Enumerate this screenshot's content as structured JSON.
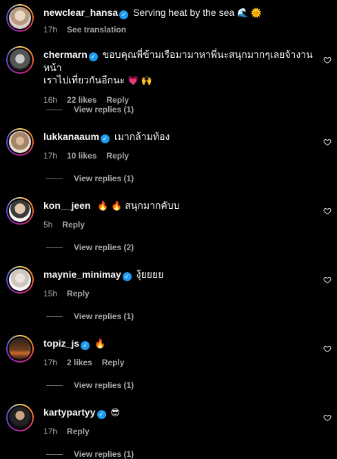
{
  "comments": [
    {
      "username": "newclear_hansa",
      "verified": true,
      "text": "Serving heat by the sea",
      "emojis": "🌊 🌞",
      "time": "17h",
      "likes": "",
      "action": "See translation",
      "replies": ""
    },
    {
      "username": "chermarn",
      "verified": true,
      "text": "ขอบคุณพี่ข้ามเรือมามาหาพี่นะสนุกมากๆเลยจ้างานหน้า",
      "text2": "เราไปเที่ยวกันอีกนะ",
      "emojis": "💗 🙌",
      "time": "16h",
      "likes": "22 likes",
      "action": "Reply",
      "replies": "View replies (1)"
    },
    {
      "username": "lukkanaaum",
      "verified": true,
      "text": "เมากล้ามท้อง",
      "emojis": "",
      "time": "17h",
      "likes": "10 likes",
      "action": "Reply",
      "replies": "View replies (1)"
    },
    {
      "username": "kon__jeen",
      "verified": false,
      "text": "สนุกมากคับบ",
      "emojis": "🔥 🔥",
      "time": "5h",
      "likes": "",
      "action": "Reply",
      "replies": "View replies (2)"
    },
    {
      "username": "maynie_minimay",
      "verified": true,
      "text": "งุ้ยยยย",
      "emojis": "",
      "time": "15h",
      "likes": "",
      "action": "Reply",
      "replies": "View replies (1)"
    },
    {
      "username": "topiz_js",
      "verified": true,
      "text": "",
      "emojis": "🔥",
      "time": "17h",
      "likes": "2 likes",
      "action": "Reply",
      "replies": "View replies (1)"
    },
    {
      "username": "kartypartyy",
      "verified": true,
      "text": "",
      "emojis": "😎",
      "time": "17h",
      "likes": "",
      "action": "Reply",
      "replies": "View replies (1)"
    }
  ],
  "colors": {
    "background": "#000000",
    "text_primary": "#f5f5f5",
    "text_secondary": "#a8a8a8",
    "verified_badge": "#1d9bf0"
  },
  "icons": {
    "verified": "verified-badge-icon",
    "like": "heart-outline-icon"
  }
}
